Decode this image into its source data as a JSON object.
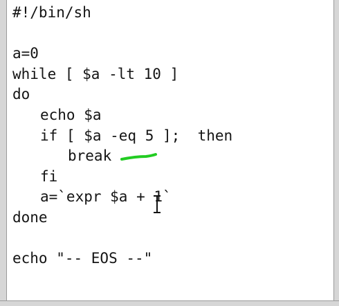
{
  "editor": {
    "lines": [
      {
        "text": "#!/bin/sh",
        "indent": 0
      },
      {
        "text": "",
        "indent": 0
      },
      {
        "text": "a=0",
        "indent": 0
      },
      {
        "text": "while [ $a -lt 10 ]",
        "indent": 0
      },
      {
        "text": "do",
        "indent": 0
      },
      {
        "text": "echo $a",
        "indent": 1
      },
      {
        "text": "if [ $a -eq 5 ];  then",
        "indent": 1
      },
      {
        "text": "break",
        "indent": 2
      },
      {
        "text": "fi",
        "indent": 1
      },
      {
        "text": "a=`expr $a + 1`",
        "indent": 1
      },
      {
        "text": "done",
        "indent": 0
      },
      {
        "text": "",
        "indent": 0
      },
      {
        "text": "echo \"-- EOS --\"",
        "indent": 0
      }
    ]
  },
  "annotation": {
    "stroke_color": "#22cc22",
    "marked_line": "break"
  },
  "cursor": {
    "icon": "i-beam-cursor-icon",
    "color": "#111111"
  },
  "theme": {
    "background": "#ffffff",
    "text_color": "#141414",
    "frame_color": "#d6d6d6"
  }
}
